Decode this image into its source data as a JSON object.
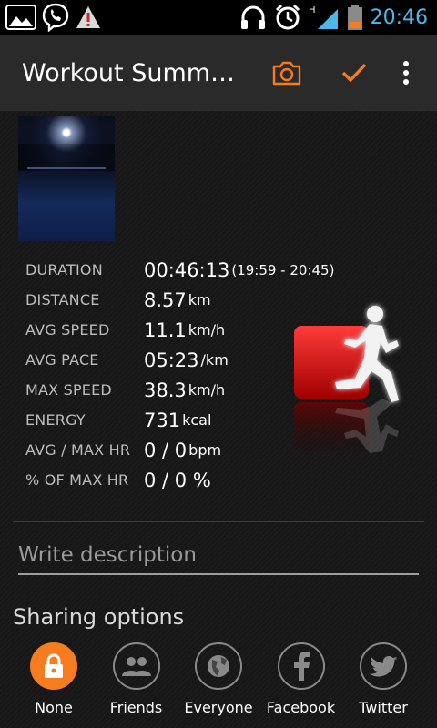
{
  "status_bar": {
    "time": "20:46",
    "network_type": "H",
    "icons": [
      "gallery-icon",
      "viber-icon",
      "warning-icon",
      "headphones-icon",
      "alarm-icon",
      "signal-icon",
      "battery-icon"
    ]
  },
  "app_bar": {
    "title": "Workout Summ…",
    "actions": [
      "camera-icon",
      "check-icon",
      "more-icon"
    ],
    "accent_color": "#f57c1f"
  },
  "stats": [
    {
      "label": "DURATION",
      "value": "00:46:13",
      "unit": "",
      "extra": "(19:59 - 20:45)"
    },
    {
      "label": "DISTANCE",
      "value": "8.57",
      "unit": "km",
      "extra": ""
    },
    {
      "label": "AVG SPEED",
      "value": "11.1",
      "unit": "km/h",
      "extra": ""
    },
    {
      "label": "AVG PACE",
      "value": "05:23",
      "unit": "/km",
      "extra": ""
    },
    {
      "label": "MAX SPEED",
      "value": "38.3",
      "unit": "km/h",
      "extra": ""
    },
    {
      "label": "ENERGY",
      "value": "731",
      "unit": "kcal",
      "extra": ""
    },
    {
      "label": "AVG / MAX HR",
      "value": "0 / 0",
      "unit": "bpm",
      "extra": ""
    },
    {
      "label": "% OF MAX HR",
      "value": "0 / 0 %",
      "unit": "",
      "extra": ""
    }
  ],
  "description": {
    "placeholder": "Write description"
  },
  "sharing": {
    "title": "Sharing options",
    "selected": "None",
    "options": [
      {
        "label": "None",
        "icon": "lock-icon"
      },
      {
        "label": "Friends",
        "icon": "friends-icon"
      },
      {
        "label": "Everyone",
        "icon": "globe-icon"
      },
      {
        "label": "Facebook",
        "icon": "facebook-icon"
      },
      {
        "label": "Twitter",
        "icon": "twitter-icon"
      }
    ]
  }
}
